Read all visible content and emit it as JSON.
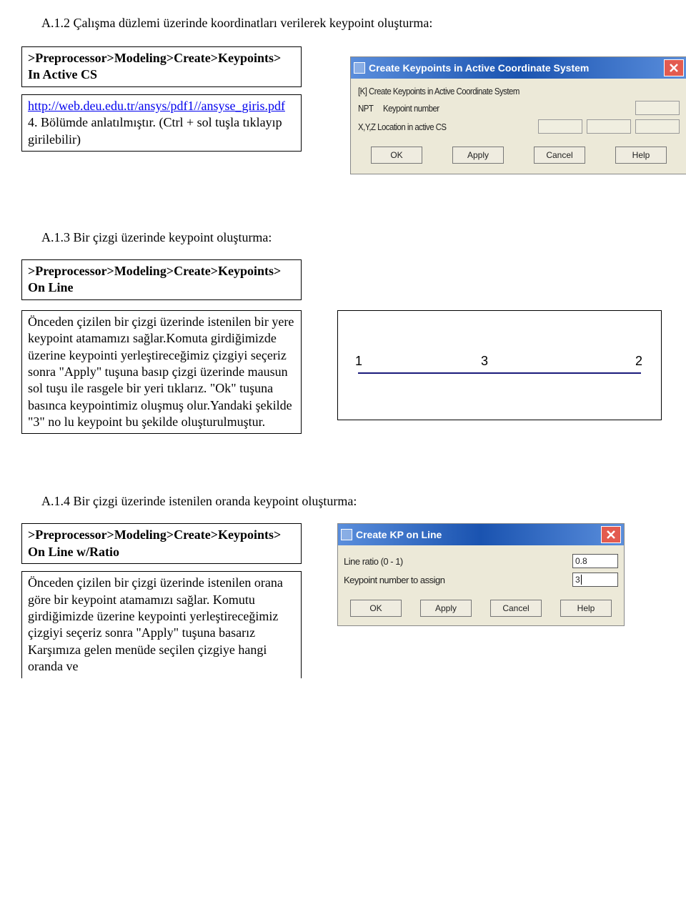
{
  "headings": {
    "a12": "A.1.2 Çalışma düzlemi üzerinde koordinatları verilerek keypoint oluşturma:",
    "a13": "A.1.3 Bir çizgi üzerinde keypoint oluşturma:",
    "a14": "A.1.4 Bir çizgi üzerinde istenilen oranda keypoint oluşturma:"
  },
  "box1": {
    "path": ">Preprocessor>Modeling>Create>Keypoints>",
    "sub": "In Active CS"
  },
  "box2_html_parts": {
    "link_text": "http://web.deu.edu.tr/ansys/pdf1//ansyse_giris.pdf",
    "rest": " 4. Bölümde anlatılmıştır. (Ctrl + sol tuşla tıklayıp girilebilir)"
  },
  "box3": {
    "path": ">Preprocessor>Modeling>Create>Keypoints>",
    "sub": "On Line"
  },
  "box4_text": "Önceden çizilen bir çizgi üzerinde istenilen bir yere keypoint atamamızı sağlar.Komuta girdiğimizde üzerine keypointi yerleştireceğimiz çizgiyi seçeriz sonra \"Apply\" tuşuna basıp çizgi üzerinde mausun sol tuşu ile  rasgele bir yeri tıklarız. \"Ok\" tuşuna basınca keypointimiz oluşmuş olur.Yandaki şekilde \"3\" no lu keypoint bu şekilde oluşturulmuştur.",
  "box5": {
    "path": ">Preprocessor>Modeling>Create>Keypoints>",
    "sub": "On Line w/Ratio"
  },
  "box6_text": "Önceden çizilen bir çizgi üzerinde istenilen orana göre bir keypoint atamamızı sağlar. Komutu girdiğimizde üzerine keypointi yerleştireceğimiz çizgiyi seçeriz sonra \"Apply\" tuşuna basarız Karşımıza gelen menüde seçilen çizgiye hangi oranda ve",
  "dialog1": {
    "title": "Create Keypoints in Active Coordinate System",
    "line1": "[K]   Create Keypoints in Active Coordinate System",
    "line2a": "NPT",
    "line2b": "Keypoint number",
    "line3": "X,Y,Z  Location in active CS",
    "buttons": {
      "ok": "OK",
      "apply": "Apply",
      "cancel": "Cancel",
      "help": "Help"
    }
  },
  "linefig": {
    "k1": "1",
    "k3": "3",
    "k2": "2"
  },
  "dialog2": {
    "title": "Create KP on Line",
    "row1": "Line ratio (0 - 1)",
    "row2": "Keypoint number to assign",
    "val1": "0.8",
    "val2": "3",
    "buttons": {
      "ok": "OK",
      "apply": "Apply",
      "cancel": "Cancel",
      "help": "Help"
    }
  }
}
